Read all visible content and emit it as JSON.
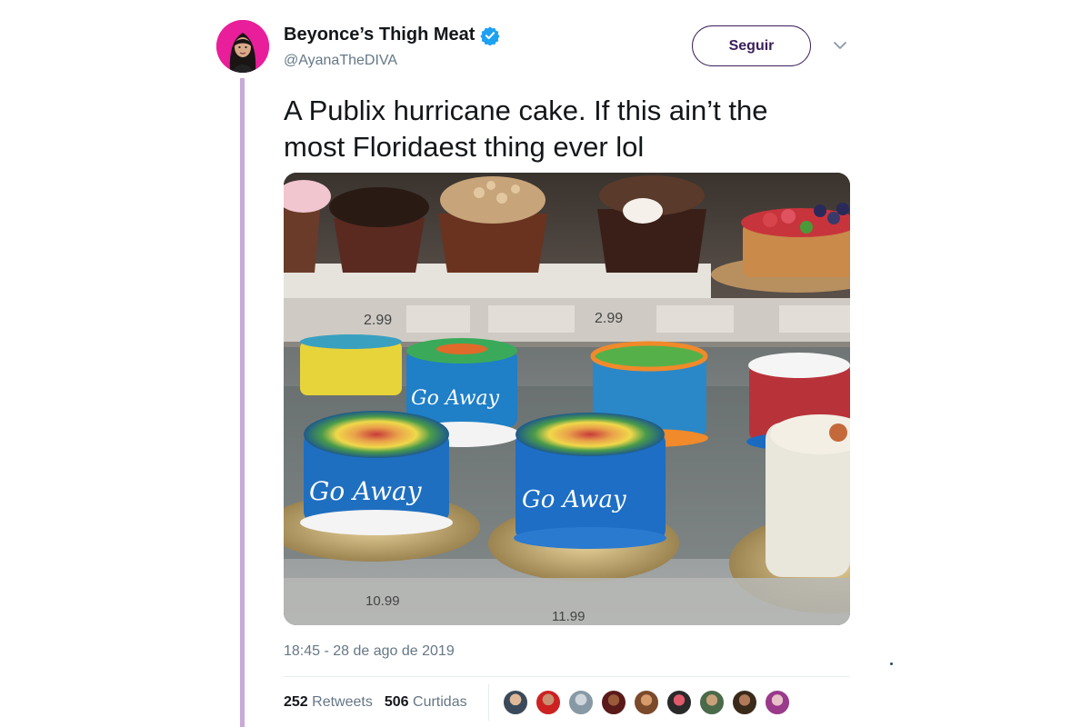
{
  "author": {
    "display_name": "Beyonce’s Thigh Meat",
    "handle": "@AyanaTheDIVA",
    "verified": true
  },
  "actions": {
    "follow_label": "Seguir"
  },
  "tweet": {
    "text_line1": "A Publix hurricane cake. If this ain’t the",
    "text_line2": "most Floridaest thing ever lol",
    "timestamp": "18:45 - 28 de ago de 2019"
  },
  "media": {
    "price_tags": [
      "2.99",
      "2.99",
      "10.99",
      "11.99"
    ],
    "cake_writing": [
      "Go Away",
      "Go Away",
      "Go Away"
    ]
  },
  "stats": {
    "retweets_count": "252",
    "retweets_label": "Retweets",
    "likes_count": "506",
    "likes_label": "Curtidas"
  },
  "likers": [
    "liker-1",
    "liker-2",
    "liker-3",
    "liker-4",
    "liker-5",
    "liker-6",
    "liker-7",
    "liker-8",
    "liker-9"
  ],
  "colors": {
    "avatar_bg": "#e91e9a",
    "verified_blue": "#1da1f2",
    "follow_border": "#3b1e5a",
    "thread_line": "#c9a9d6",
    "secondary_text": "#657786"
  }
}
